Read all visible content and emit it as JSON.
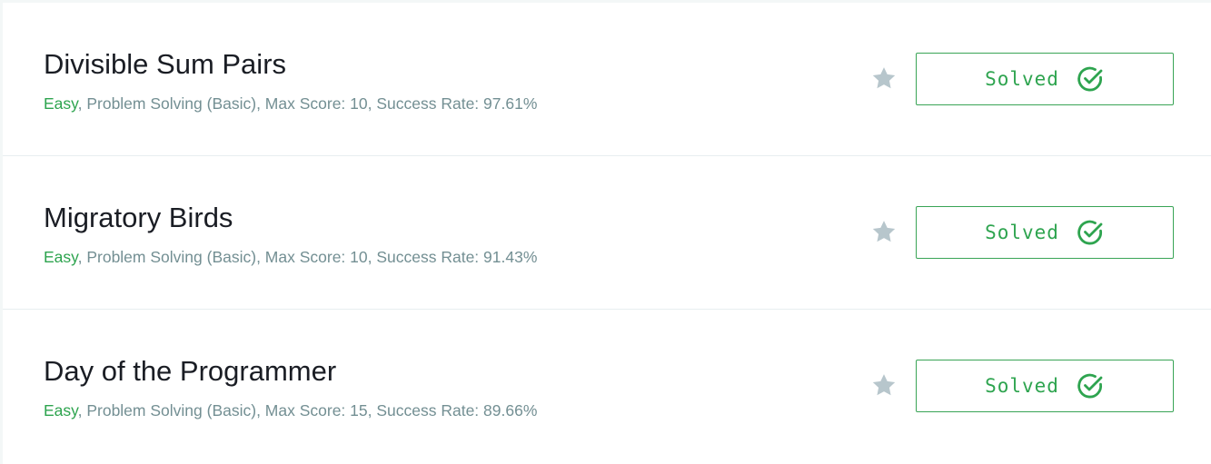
{
  "challenges": [
    {
      "title": "Divisible Sum Pairs",
      "difficulty": "Easy",
      "details": ", Problem Solving (Basic), Max Score: 10, Success Rate: 97.61%",
      "status_label": "Solved"
    },
    {
      "title": "Migratory Birds",
      "difficulty": "Easy",
      "details": ", Problem Solving (Basic), Max Score: 10, Success Rate: 91.43%",
      "status_label": "Solved"
    },
    {
      "title": "Day of the Programmer",
      "difficulty": "Easy",
      "details": ", Problem Solving (Basic), Max Score: 15, Success Rate: 89.66%",
      "status_label": "Solved"
    }
  ],
  "icons": {
    "bookmark": "star-icon",
    "status": "check-circle-icon"
  },
  "colors": {
    "accent_green": "#2ea44f",
    "meta_gray": "#738f93",
    "star_gray": "#b7c6cc"
  }
}
